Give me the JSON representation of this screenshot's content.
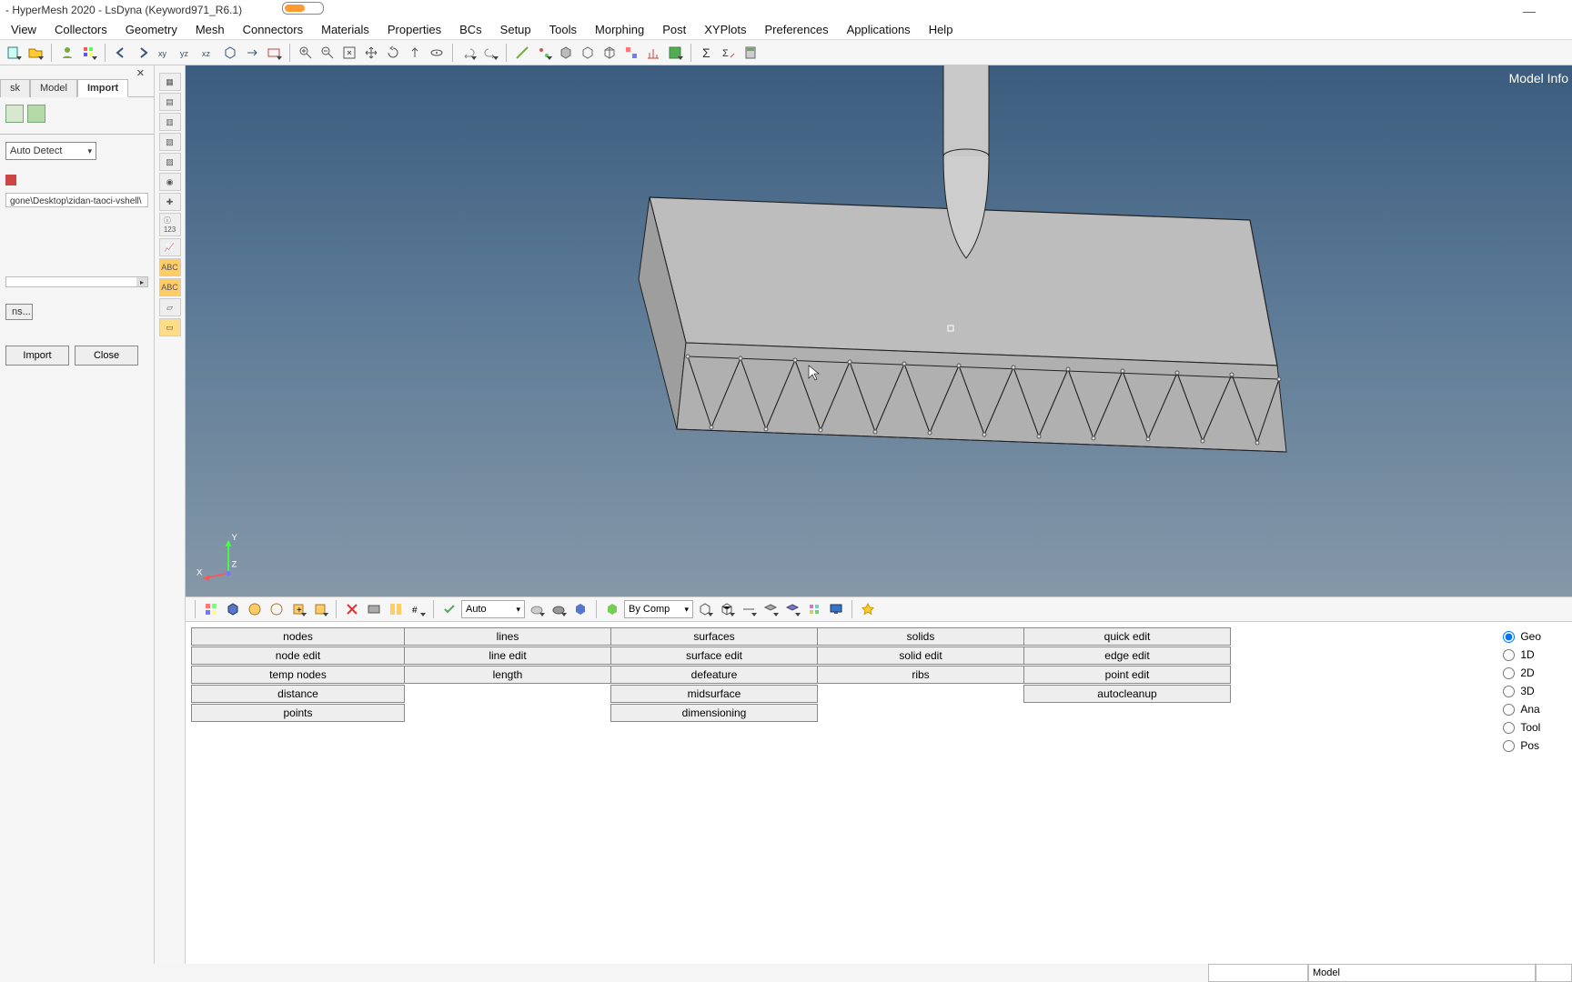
{
  "title": "- HyperMesh 2020 - LsDyna (Keyword971_R6.1)",
  "menu": [
    "View",
    "Collectors",
    "Geometry",
    "Mesh",
    "Connectors",
    "Materials",
    "Properties",
    "BCs",
    "Setup",
    "Tools",
    "Morphing",
    "Post",
    "XYPlots",
    "Preferences",
    "Applications",
    "Help"
  ],
  "left": {
    "tabs": [
      "sk",
      "Model",
      "Import"
    ],
    "active_tab": "Import",
    "filetype": "Auto Detect",
    "path": "gone\\Desktop\\zidan-taoci-vshell\\",
    "options_btn": "ns...",
    "import_btn": "Import",
    "close_btn": "Close"
  },
  "viewport": {
    "overlay": "Model Info",
    "axes": {
      "x": "X",
      "y": "Y",
      "z": "Z"
    }
  },
  "lower_toolbar": {
    "auto": "Auto",
    "bycomp": "By Comp"
  },
  "panels": {
    "col1": [
      "nodes",
      "node edit",
      "temp nodes",
      "distance",
      "points"
    ],
    "col2": [
      "lines",
      "line edit",
      "length"
    ],
    "col3": [
      "surfaces",
      "surface edit",
      "defeature",
      "midsurface",
      "dimensioning"
    ],
    "col4": [
      "solids",
      "solid edit",
      "ribs"
    ],
    "col5": [
      "quick edit",
      "edge edit",
      "point edit",
      "autocleanup"
    ],
    "radios": [
      "Geo",
      "1D",
      "2D",
      "3D",
      "Ana",
      "Tool",
      "Pos"
    ],
    "radio_selected": "Geo"
  },
  "statusbar": {
    "model": "Model"
  }
}
